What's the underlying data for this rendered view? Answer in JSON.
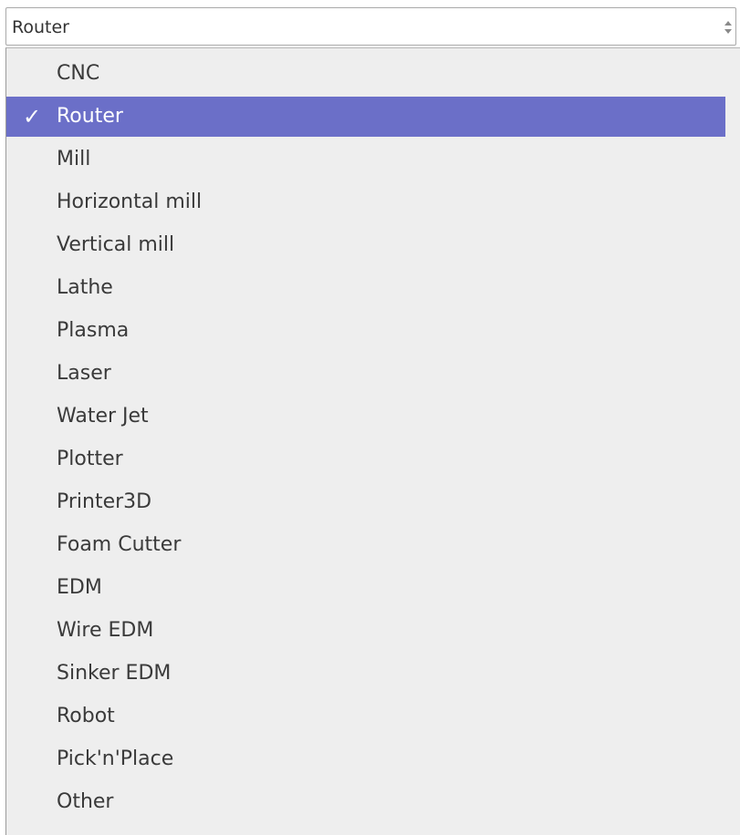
{
  "select": {
    "value": "Router",
    "arrows_icon": "up-down-arrows-icon"
  },
  "dropdown": {
    "selected_index": 1,
    "checkmark_icon": "checkmark-icon",
    "checkmark_glyph": "✓",
    "highlight_color": "#6b6fc8",
    "options": [
      "CNC",
      "Router",
      "Mill",
      "Horizontal mill",
      "Vertical mill",
      "Lathe",
      "Plasma",
      "Laser",
      "Water Jet",
      "Plotter",
      "Printer3D",
      "Foam Cutter",
      "EDM",
      "Wire EDM",
      "Sinker EDM",
      "Robot",
      "Pick'n'Place",
      "Other"
    ]
  }
}
